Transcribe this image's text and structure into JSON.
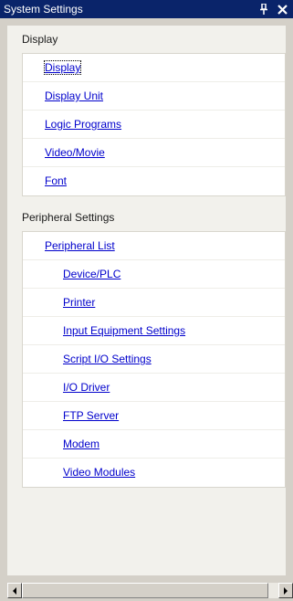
{
  "window": {
    "title": "System Settings",
    "pin_icon": "pin-icon",
    "close_icon": "close-icon"
  },
  "sections": [
    {
      "header": "Display",
      "items": [
        {
          "label": "Display",
          "focused": true
        },
        {
          "label": "Display Unit"
        },
        {
          "label": "Logic Programs"
        },
        {
          "label": "Video/Movie"
        },
        {
          "label": "Font"
        }
      ]
    },
    {
      "header": "Peripheral Settings",
      "items": [
        {
          "label": "Peripheral List"
        },
        {
          "label": "Device/PLC",
          "indent": true
        },
        {
          "label": "Printer",
          "indent": true
        },
        {
          "label": "Input Equipment Settings",
          "indent": true
        },
        {
          "label": "Script I/O Settings",
          "indent": true
        },
        {
          "label": "I/O Driver",
          "indent": true
        },
        {
          "label": "FTP Server",
          "indent": true
        },
        {
          "label": "Modem",
          "indent": true
        },
        {
          "label": "Video Modules",
          "indent": true
        }
      ]
    }
  ],
  "scrollbar": {
    "left_arrow_icon": "arrow-left-icon",
    "right_arrow_icon": "arrow-right-icon"
  },
  "colors": {
    "titlebar": "#0a246a",
    "link": "#0000cc",
    "panel": "#f2f1ec"
  }
}
